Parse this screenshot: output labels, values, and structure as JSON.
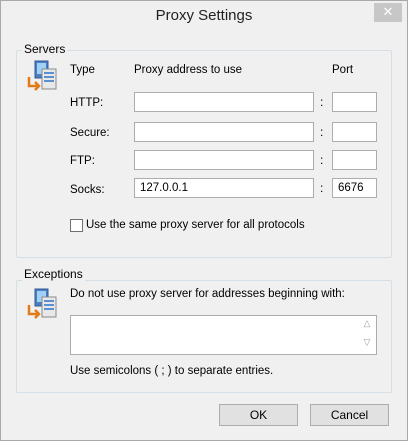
{
  "window": {
    "title": "Proxy Settings",
    "close_glyph": "✕"
  },
  "servers": {
    "group_label": "Servers",
    "col_type": "Type",
    "col_address": "Proxy address to use",
    "col_port": "Port",
    "separator": ":",
    "rows": [
      {
        "label": "HTTP:",
        "address": "",
        "port": ""
      },
      {
        "label": "Secure:",
        "address": "",
        "port": ""
      },
      {
        "label": "FTP:",
        "address": "",
        "port": ""
      },
      {
        "label": "Socks:",
        "address": "127.0.0.1",
        "port": "6676"
      }
    ],
    "same_proxy_label": "Use the same proxy server for all protocols",
    "same_proxy_checked": false
  },
  "exceptions": {
    "group_label": "Exceptions",
    "description": "Do not use proxy server for addresses beginning with:",
    "value": "",
    "hint": "Use semicolons ( ; ) to separate entries."
  },
  "buttons": {
    "ok": "OK",
    "cancel": "Cancel"
  },
  "colors": {
    "close_button": "#c7c7c7",
    "dialog_bg": "#f0f0f0",
    "group_border": "#d5dfe5"
  }
}
